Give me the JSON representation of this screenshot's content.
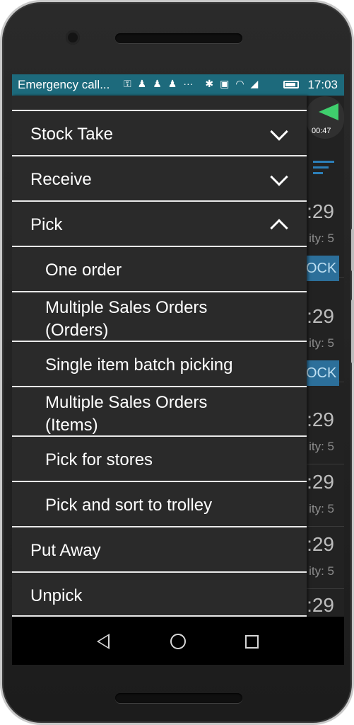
{
  "status_bar": {
    "carrier": "Emergency call...",
    "icons": [
      "notification-icon",
      "person-icon",
      "person-icon",
      "person-icon",
      "more-icon",
      "bluetooth-icon",
      "nfc-icon",
      "wifi-icon",
      "signal-icon",
      "battery-icon"
    ],
    "time": "17:03"
  },
  "background_app": {
    "timer": "00:47",
    "rows": [
      {
        "time": ":29",
        "qty": "ity: 5",
        "button": "OCK"
      },
      {
        "time": ":29",
        "qty": "ity: 5",
        "button": "OCK"
      },
      {
        "time": ":29",
        "qty": "ity: 5"
      },
      {
        "time": ":29",
        "qty": "ity: 5"
      },
      {
        "time": ":29",
        "qty": "ity: 5"
      },
      {
        "time": ":29"
      }
    ]
  },
  "drawer": {
    "items": [
      {
        "label": "Stock Take",
        "state": "collapsed"
      },
      {
        "label": "Receive",
        "state": "collapsed"
      },
      {
        "label": "Pick",
        "state": "expanded"
      }
    ],
    "pick_sub_items": [
      {
        "label": "One order"
      },
      {
        "label": "Multiple Sales Orders (Orders)"
      },
      {
        "label": "Single item batch picking"
      },
      {
        "label": "Multiple Sales Orders (Items)"
      },
      {
        "label": "Pick for stores"
      },
      {
        "label": "Pick and sort to trolley"
      }
    ],
    "after_items": [
      {
        "label": "Put Away"
      },
      {
        "label": "Unpick"
      }
    ]
  },
  "nav_bar": {
    "buttons": [
      "back-icon",
      "home-icon",
      "recents-icon"
    ]
  },
  "colors": {
    "status_bar": "#1d6a7c",
    "drawer_bg": "#2a2a2a",
    "divider": "#e9e9e9",
    "accent_green": "#3fcf6d",
    "accent_blue": "#2c6f9a"
  }
}
